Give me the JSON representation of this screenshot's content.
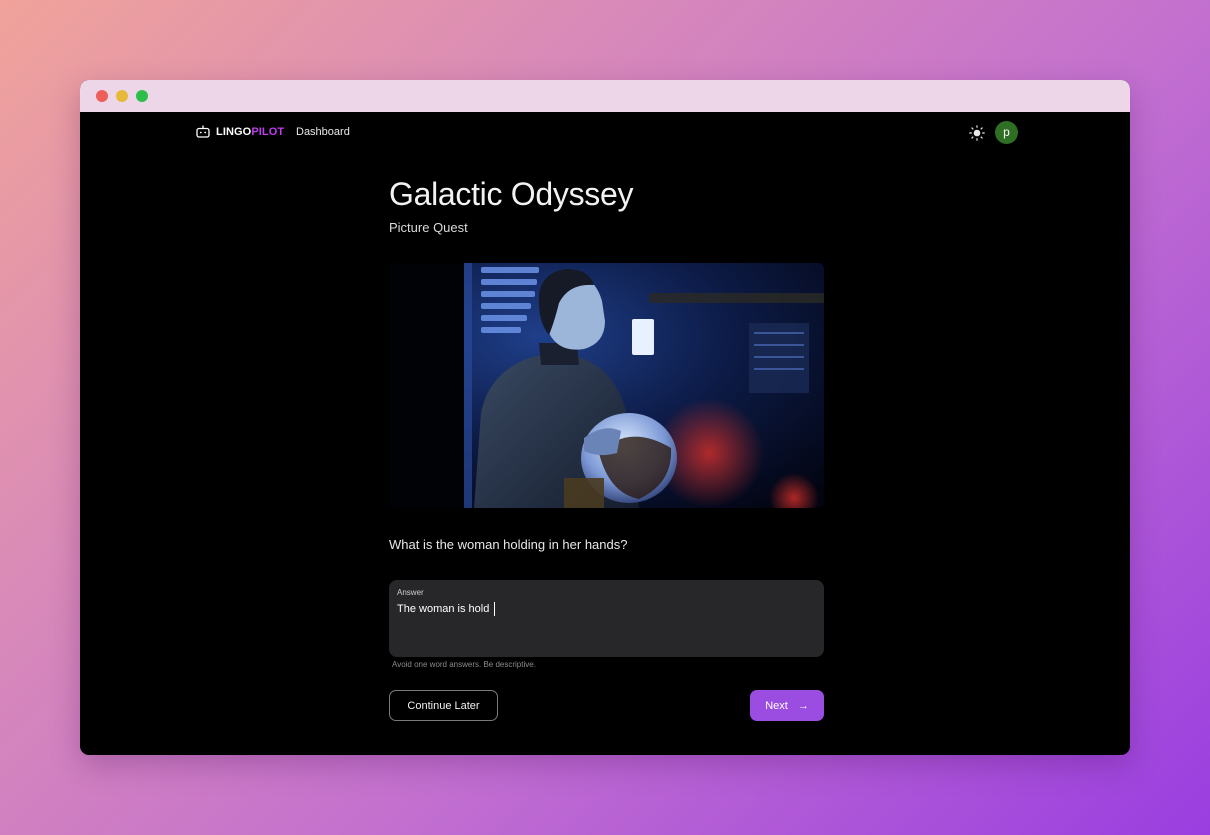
{
  "window": {
    "accent": "#9a4de0",
    "brand_accent": "#c03cf0"
  },
  "nav": {
    "logo_part1": "LINGO",
    "logo_part2": "PILOT",
    "links": [
      {
        "label": "Dashboard"
      }
    ],
    "theme_icon": "sun-icon",
    "avatar_initial": "p",
    "avatar_color": "#2f6f24"
  },
  "page": {
    "title": "Galactic Odyssey",
    "subtitle": "Picture Quest",
    "image_icon": "astronaut-photo",
    "question": "What is the woman holding in her hands?"
  },
  "answer": {
    "label": "Answer",
    "value": "The woman is hold",
    "helper": "Avoid one word answers. Be descriptive."
  },
  "actions": {
    "continue_label": "Continue Later",
    "next_label": "Next",
    "next_icon": "arrow-right-icon"
  }
}
